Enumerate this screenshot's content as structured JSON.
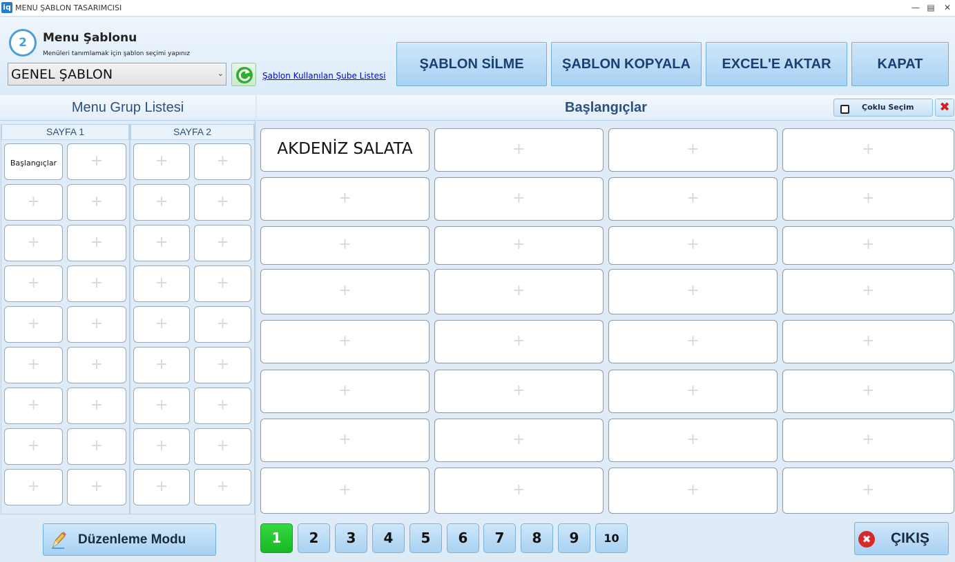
{
  "window": {
    "app_icon": "iq",
    "title": "MENU ŞABLON TASARIMCISI",
    "minimize_icon": "minimize-icon",
    "maximize_icon": "maximize-icon",
    "close_icon": "close-icon"
  },
  "header": {
    "step_number": "2",
    "title": "Menu Şablonu",
    "subtitle": "Menüleri tanımlamak için şablon seçimi yapınız",
    "template_select": {
      "value": "GENEL ŞABLON",
      "arrow_icon": "chevron-down-icon"
    },
    "refresh_icon": "refresh-icon",
    "branch_link": "Şablon Kullanılan Şube Listesi",
    "buttons": {
      "delete": "ŞABLON SİLME",
      "copy": "ŞABLON KOPYALA",
      "export": "EXCEL'E AKTAR",
      "close": "KAPAT"
    }
  },
  "group_list": {
    "title": "Menu Grup Listesi",
    "pages": [
      {
        "label": "SAYFA 1",
        "cells": [
          "Başlangıçlar",
          "",
          "",
          "",
          "",
          "",
          "",
          "",
          "",
          "",
          "",
          "",
          "",
          "",
          "",
          "",
          "",
          ""
        ]
      },
      {
        "label": "SAYFA 2",
        "cells": [
          "",
          "",
          "",
          "",
          "",
          "",
          "",
          "",
          "",
          "",
          "",
          "",
          "",
          "",
          "",
          "",
          "",
          ""
        ]
      }
    ],
    "empty_cell_symbol": "+",
    "edit_mode_button": "Düzenleme Modu",
    "edit_icon": "pencil-icon"
  },
  "items": {
    "title": "Başlangıçlar",
    "multi_select_label": "Çoklu Seçim",
    "multi_select_checked": false,
    "close_symbol": "✖",
    "empty_cell_symbol": "+",
    "cells": [
      "AKDENİZ SALATA",
      "",
      "",
      "",
      "",
      "",
      "",
      "",
      "",
      "",
      "",
      "",
      "",
      "",
      "",
      "",
      "",
      "",
      "",
      "",
      "",
      "",
      "",
      "",
      "",
      "",
      "",
      "",
      "",
      "",
      "",
      ""
    ],
    "pagination": [
      "1",
      "2",
      "3",
      "4",
      "5",
      "6",
      "7",
      "8",
      "9",
      "10"
    ],
    "active_page": "1",
    "exit_button": "ÇIKIŞ",
    "exit_symbol": "✖",
    "active_page_color": "#1fc22c"
  }
}
